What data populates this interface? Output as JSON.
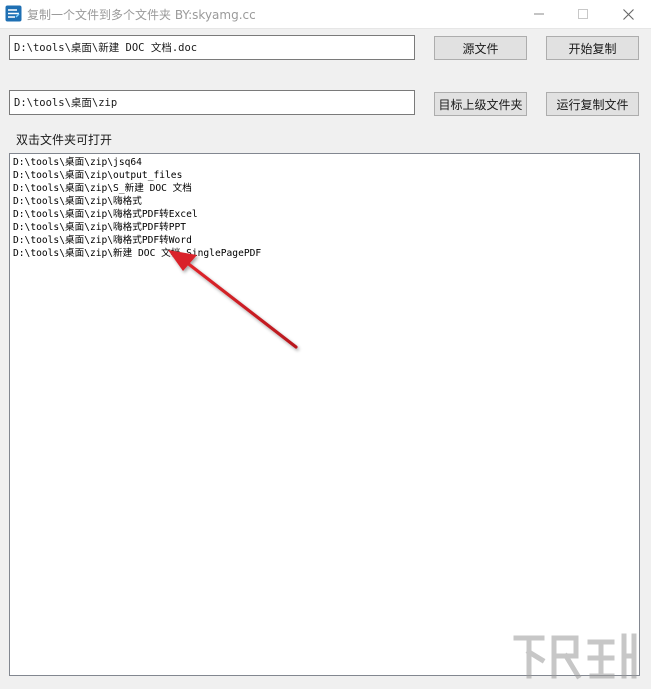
{
  "window": {
    "title": "复制一个文件到多个文件夹   BY:skyamg.cc",
    "app_icon": "lines-app-icon",
    "controls": {
      "minimize_icon": "minimize-icon",
      "maximize_icon": "maximize-icon",
      "close_icon": "close-icon"
    }
  },
  "source": {
    "path_value": "D:\\tools\\桌面\\新建 DOC 文档.doc",
    "source_button_label": "源文件",
    "start_copy_button_label": "开始复制"
  },
  "target": {
    "path_value": "D:\\tools\\桌面\\zip",
    "parent_folder_button_label": "目标上级文件夹",
    "run_copy_button_label": "运行复制文件"
  },
  "list": {
    "hint_label": "双击文件夹可打开",
    "items": [
      "D:\\tools\\桌面\\zip\\jsq64",
      "D:\\tools\\桌面\\zip\\output_files",
      "D:\\tools\\桌面\\zip\\S_新建 DOC 文档",
      "D:\\tools\\桌面\\zip\\嗨格式",
      "D:\\tools\\桌面\\zip\\嗨格式PDF转Excel",
      "D:\\tools\\桌面\\zip\\嗨格式PDF转PPT",
      "D:\\tools\\桌面\\zip\\嗨格式PDF转Word",
      "D:\\tools\\桌面\\zip\\新建 DOC 文档_SinglePagePDF"
    ]
  },
  "annotation": {
    "arrow_color": "#d9232a",
    "arrow_icon": "red-annotation-arrow"
  },
  "watermark": {
    "icon": "site-watermark-logo"
  }
}
